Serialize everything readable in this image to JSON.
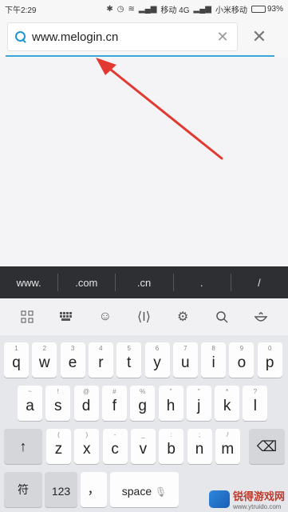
{
  "status_bar": {
    "time": "下午2:29",
    "carrier1": "移动 4G",
    "carrier2": "小米移动",
    "battery_percent": "93%",
    "battery_level": 0.93
  },
  "address_bar": {
    "url": "www.melogin.cn",
    "clear_icon": "close-icon",
    "close_icon": "close-icon"
  },
  "suggestions": [
    "www.",
    ".com",
    ".cn",
    ".",
    "/"
  ],
  "toolbar_icons": [
    "grid-icon",
    "numpad-icon",
    "emoji-icon",
    "cursor-icon",
    "settings-icon",
    "search-icon",
    "voice-bowl-icon"
  ],
  "keyboard": {
    "row1": [
      {
        "hint": "1",
        "key": "q"
      },
      {
        "hint": "2",
        "key": "w"
      },
      {
        "hint": "3",
        "key": "e"
      },
      {
        "hint": "4",
        "key": "r"
      },
      {
        "hint": "5",
        "key": "t"
      },
      {
        "hint": "6",
        "key": "y"
      },
      {
        "hint": "7",
        "key": "u"
      },
      {
        "hint": "8",
        "key": "i"
      },
      {
        "hint": "9",
        "key": "o"
      },
      {
        "hint": "0",
        "key": "p"
      }
    ],
    "row2": [
      {
        "hint": "~",
        "key": "a"
      },
      {
        "hint": "!",
        "key": "s"
      },
      {
        "hint": "@",
        "key": "d"
      },
      {
        "hint": "#",
        "key": "f"
      },
      {
        "hint": "%",
        "key": "g"
      },
      {
        "hint": "\"",
        "key": "h"
      },
      {
        "hint": "\"",
        "key": "j"
      },
      {
        "hint": "*",
        "key": "k"
      },
      {
        "hint": "?",
        "key": "l"
      }
    ],
    "row3": [
      {
        "hint": "(",
        "key": "z"
      },
      {
        "hint": ")",
        "key": "x"
      },
      {
        "hint": "-",
        "key": "c"
      },
      {
        "hint": "_",
        "key": "v"
      },
      {
        "hint": ":",
        "key": "b"
      },
      {
        "hint": ";",
        "key": "n"
      },
      {
        "hint": "/",
        "key": "m"
      }
    ],
    "shift_label": "↑",
    "backspace_label": "⌫",
    "symbol_label": "符",
    "numbers_label": "123",
    "comma_label": "，",
    "space_label": "space",
    "mic_icon": "microphone-icon"
  },
  "watermark": {
    "title": "锐得游戏网",
    "url": "www.ytruido.com"
  }
}
